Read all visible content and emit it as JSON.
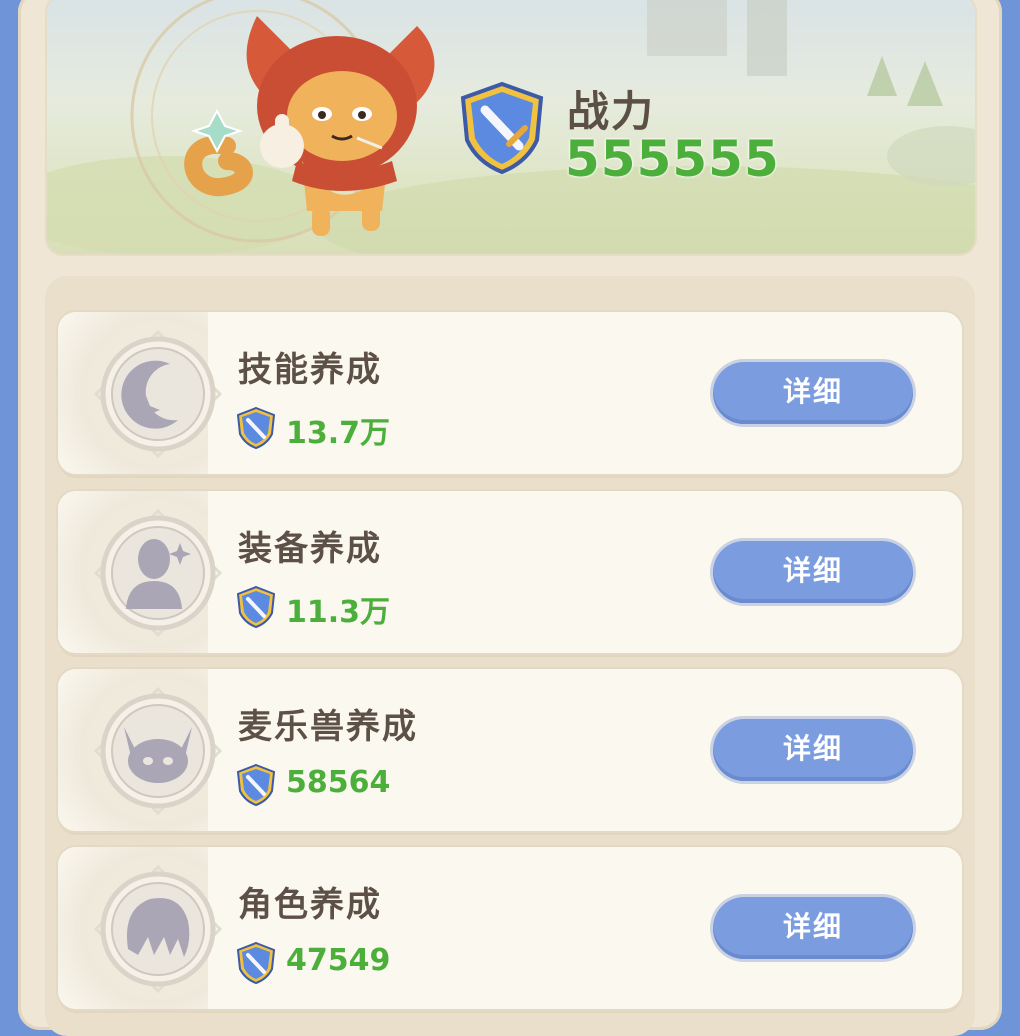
{
  "header": {
    "power_label": "战力",
    "power_value": "555555",
    "character": "fox-cat-mascot"
  },
  "rows": [
    {
      "title": "技能养成",
      "value": "13.7万",
      "button": "详细",
      "icon": "moon-star-icon"
    },
    {
      "title": "装备养成",
      "value": "11.3万",
      "button": "详细",
      "icon": "person-sparkle-icon"
    },
    {
      "title": "麦乐兽养成",
      "value": "58564",
      "button": "详细",
      "icon": "cat-face-icon"
    },
    {
      "title": "角色养成",
      "value": "47549",
      "button": "详细",
      "icon": "hair-head-icon"
    }
  ],
  "colors": {
    "accent_green": "#4caf3b",
    "button_blue": "#7b9de0",
    "frame_blue": "#6f95d8"
  }
}
